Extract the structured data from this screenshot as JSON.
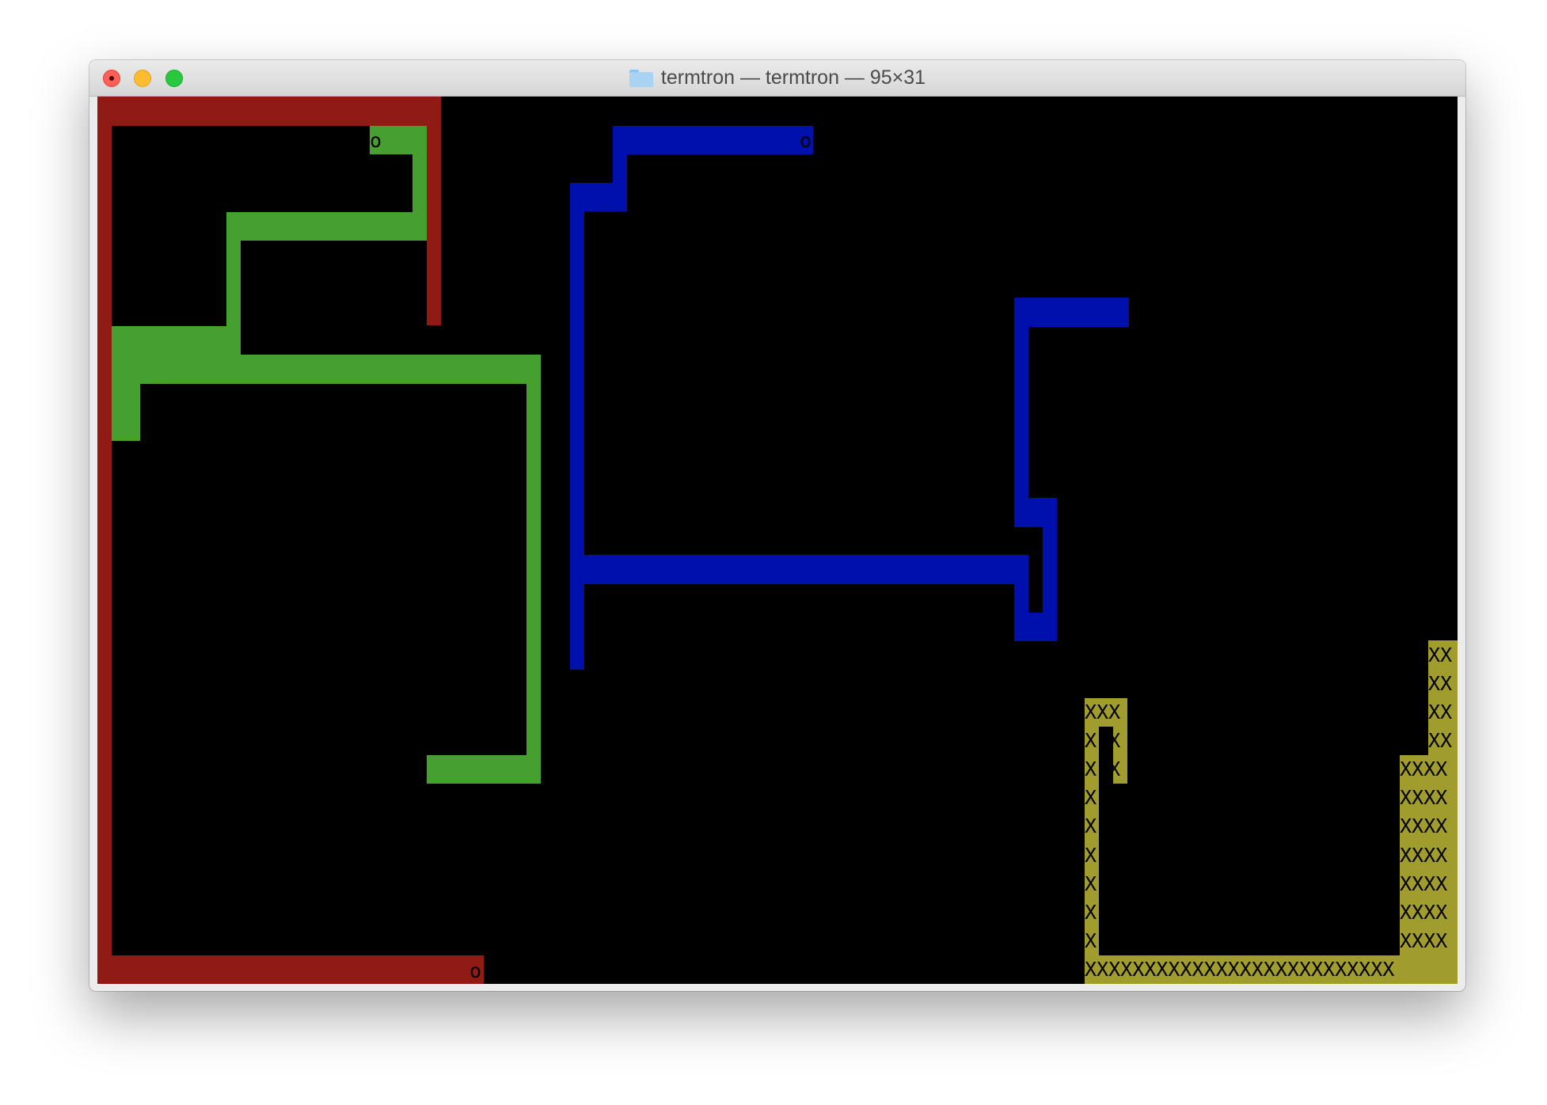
{
  "window": {
    "title": "termtron — termtron — 95×31"
  },
  "game": {
    "head_marker": "o",
    "trail_marker": "X",
    "colors": {
      "red": "#8f1b14",
      "green": "#46a02f",
      "blue": "#0010ad",
      "yellow": "#a09c2e",
      "background": "#000000"
    },
    "rows": {
      "xxx": "XXX",
      "x_x": "X X",
      "x": "X",
      "xx": "XX",
      "xxxx": "XXXX",
      "bottom": "XXXXXXXXXXXXXXXXXXXXXXXXXX"
    }
  }
}
